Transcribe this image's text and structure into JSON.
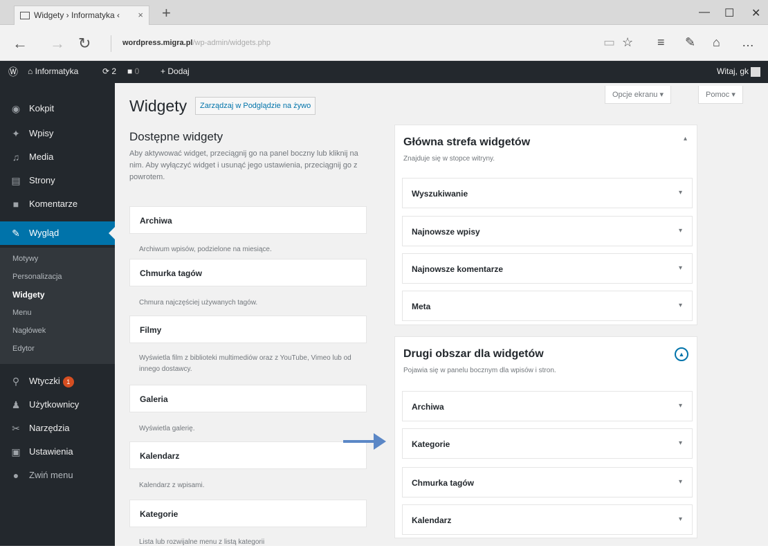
{
  "browser": {
    "tab_title": "Widgety › Informatyka ‹",
    "tab_close": "×",
    "new_tab": "+",
    "url_host": "wordpress.migra.pl",
    "url_path": "/wp-admin/widgets.php"
  },
  "admin_bar": {
    "site_name": "Informatyka",
    "updates_count": "2",
    "comments_count": "0",
    "add_new_label": "Dodaj",
    "greeting": "Witaj, gk"
  },
  "sidebar": {
    "items": [
      {
        "label": "Kokpit",
        "icon": "dashboard-icon"
      },
      {
        "label": "Wpisy",
        "icon": "pin-icon"
      },
      {
        "label": "Media",
        "icon": "media-icon"
      },
      {
        "label": "Strony",
        "icon": "page-icon"
      },
      {
        "label": "Komentarze",
        "icon": "comment-icon"
      },
      {
        "label": "Wygląd",
        "icon": "appearance-icon"
      },
      {
        "label": "Wtyczki",
        "icon": "plugin-icon",
        "badge": "1"
      },
      {
        "label": "Użytkownicy",
        "icon": "users-icon"
      },
      {
        "label": "Narzędzia",
        "icon": "tools-icon"
      },
      {
        "label": "Ustawienia",
        "icon": "settings-icon"
      },
      {
        "label": "Zwiń menu",
        "icon": "collapse-icon"
      }
    ],
    "submenu": [
      "Motywy",
      "Personalizacja",
      "Widgety",
      "Menu",
      "Nagłówek",
      "Edytor"
    ]
  },
  "header": {
    "screen_options": "Opcje ekranu",
    "help": "Pomoc",
    "title": "Widgety",
    "live_button": "Zarządzaj w Podglądzie na żywo"
  },
  "available": {
    "title": "Dostępne widgety",
    "description": "Aby aktywować widget, przeciągnij go na panel boczny lub kliknij na nim. Aby wyłączyć widget i usunąć jego ustawienia, przeciągnij go z powrotem.",
    "widgets": [
      {
        "name": "Archiwa",
        "desc": "Archiwum wpisów, podzielone na miesiące."
      },
      {
        "name": "Chmurka tagów",
        "desc": "Chmura najczęściej używanych tagów."
      },
      {
        "name": "Filmy",
        "desc": "Wyświetla film z biblioteki multimediów oraz z YouTube, Vimeo lub od innego dostawcy."
      },
      {
        "name": "Galeria",
        "desc": "Wyświetla galerię."
      },
      {
        "name": "Kalendarz",
        "desc": "Kalendarz z wpisami."
      },
      {
        "name": "Kategorie",
        "desc": "Lista lub rozwijalne menu z listą kategorii"
      }
    ]
  },
  "main_area": {
    "title": "Główna strefa widgetów",
    "description": "Znajduje się w stopce witryny.",
    "widgets": [
      "Wyszukiwanie",
      "Najnowsze wpisy",
      "Najnowsze komentarze",
      "Meta"
    ]
  },
  "second_area": {
    "title": "Drugi obszar dla widgetów",
    "description": "Pojawia się w panelu bocznym dla wpisów i stron.",
    "widgets": [
      "Archiwa",
      "Kategorie",
      "Chmurka tagów",
      "Kalendarz"
    ]
  },
  "colors": {
    "admin_dark": "#23282d",
    "accent": "#0073aa",
    "arrow": "#5b87c6"
  }
}
